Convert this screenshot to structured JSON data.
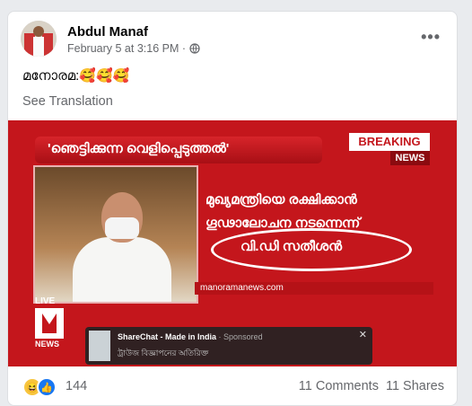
{
  "post": {
    "author": "Abdul Manaf",
    "timestamp": "February 5 at 3:16 PM ·",
    "privacy_icon": "globe-icon",
    "more_icon": "ellipsis-icon",
    "text": "മനോരമ:🥰🥰🥰",
    "see_translation": "See Translation"
  },
  "media": {
    "banner": "'ഞെട്ടിക്കുന്ന വെളിപ്പെടുത്തൽ'",
    "breaking": "BREAKING",
    "news": "NEWS",
    "headline_line1": "മുഖ്യമന്ത്രിയെ രക്ഷിക്കാൻ",
    "headline_line2": "ഗൂഢാലോചന നടന്നെന്ന്",
    "circled_name": "വി.ഡി സതീശൻ",
    "url": "manoramanews.com",
    "live": "LIVE",
    "news_label": "NEWS",
    "ad_title": "ShareChat - Made in India",
    "ad_sponsored": "· Sponsored",
    "ad_subtitle": "ট্রাউজ বিজ্ঞাপনের অতিরিক্ত"
  },
  "footer": {
    "reaction_count": "144",
    "comments": "11 Comments",
    "shares": "11 Shares"
  }
}
